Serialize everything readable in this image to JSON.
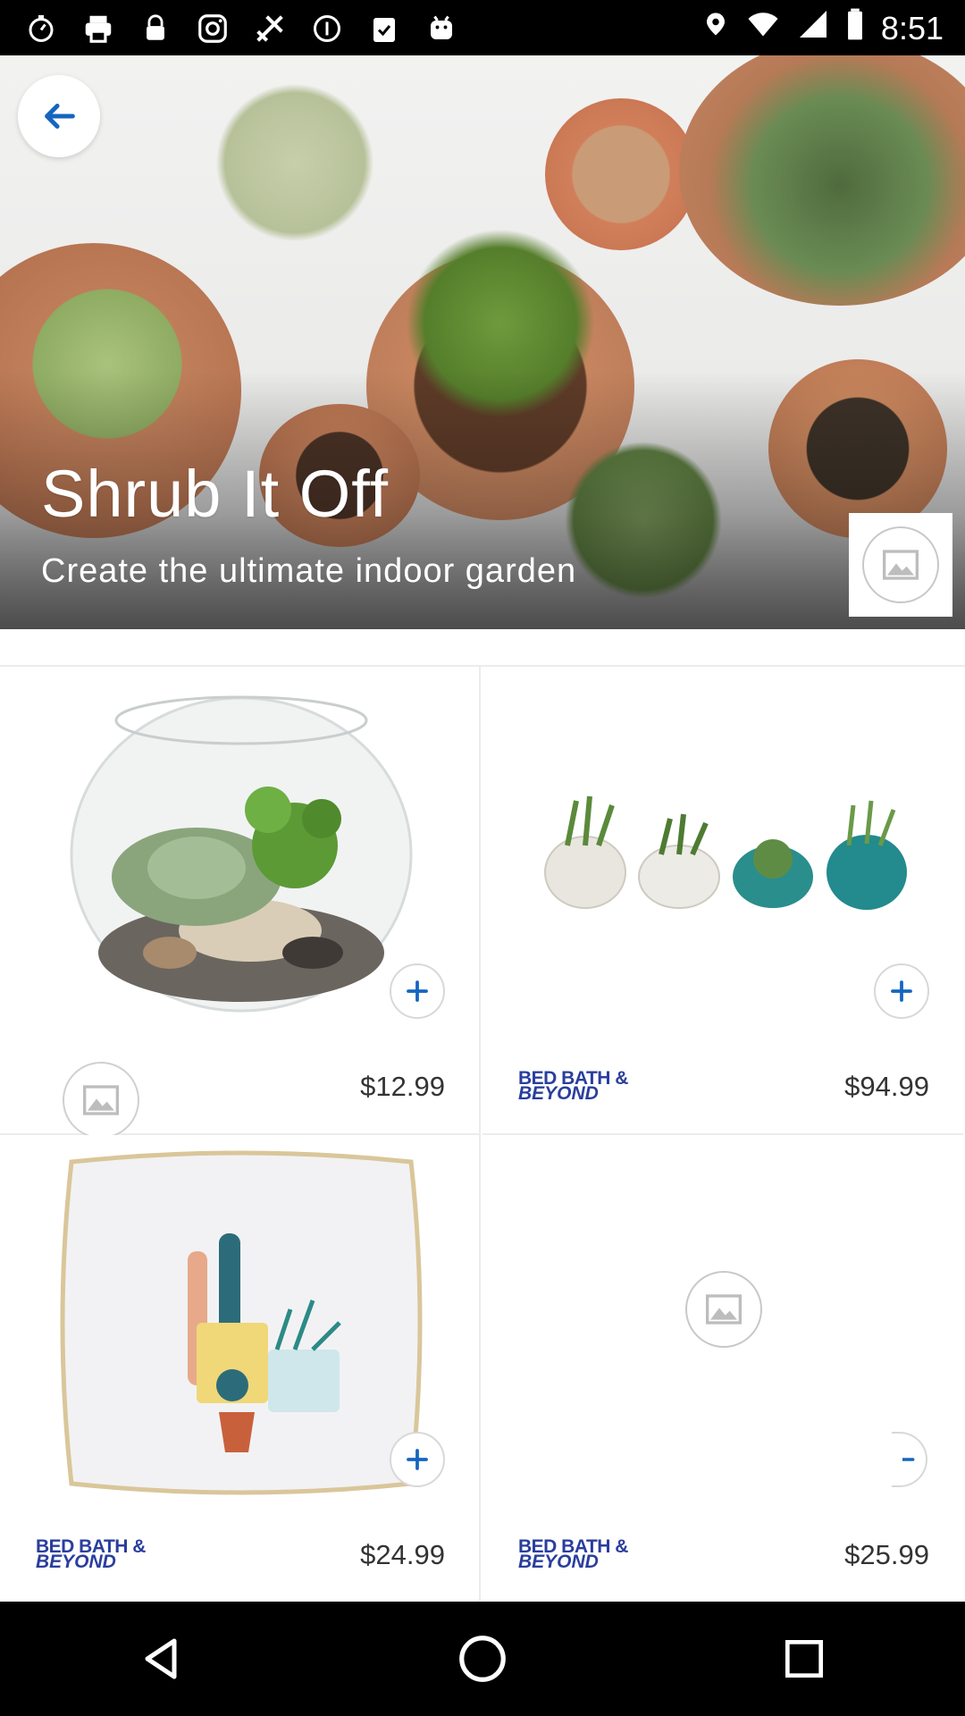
{
  "status_bar": {
    "time": "8:51",
    "icons": [
      "stopwatch-icon",
      "printer-icon",
      "lock-icon",
      "instagram-icon",
      "fake-gps-icon",
      "info-icon",
      "clipboard-check-icon",
      "android-icon"
    ],
    "right_icons": [
      "location-icon",
      "wifi-icon",
      "signal-icon",
      "battery-icon"
    ]
  },
  "hero": {
    "title": "Shrub It Off",
    "subtitle": "Create the ultimate indoor garden",
    "back_icon": "arrow-left-icon",
    "image_icon": "image-icon"
  },
  "products": [
    {
      "price": "$12.99",
      "brand_text": "",
      "has_brand_logo": false,
      "image": "glass terrarium bowl with succulents"
    },
    {
      "price": "$94.99",
      "brand_text_1": "BED BATH &",
      "brand_text_2": "BEYOND",
      "has_brand_logo": true,
      "image": "shell planters set"
    },
    {
      "price": "$24.99",
      "brand_text_1": "BED BATH &",
      "brand_text_2": "BEYOND",
      "has_brand_logo": true,
      "image": "embroidered cactus pillow"
    },
    {
      "price": "$25.99",
      "brand_text_1": "BED BATH &",
      "brand_text_2": "BEYOND",
      "has_brand_logo": true,
      "image": "loading image placeholder"
    }
  ],
  "colors": {
    "accent": "#1565c0",
    "brand": "#2a3e9d",
    "price_text": "#333333"
  },
  "nav": [
    "back-nav-icon",
    "home-nav-icon",
    "recents-nav-icon"
  ]
}
